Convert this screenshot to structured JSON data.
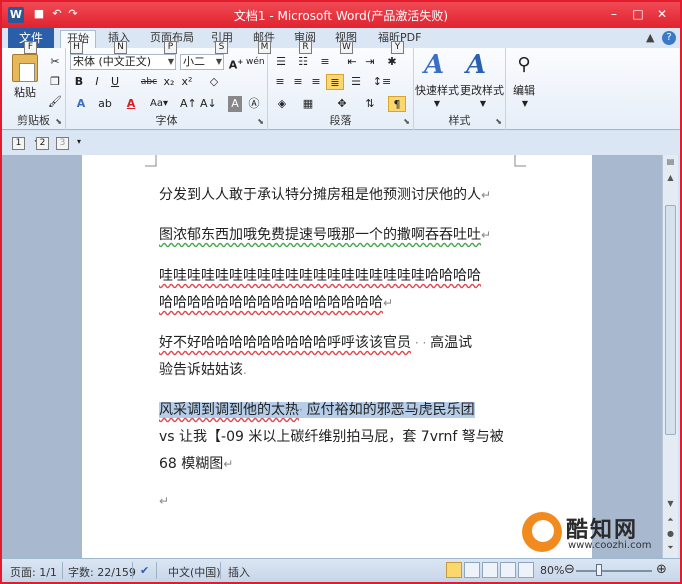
{
  "title_bar": {
    "app_icon": "W",
    "title": "文档1 - Microsoft Word(产品激活失败)",
    "keytips": [
      "1",
      "2",
      "3"
    ]
  },
  "tabs": [
    {
      "label": "文件",
      "key": "F"
    },
    {
      "label": "开始",
      "key": "H"
    },
    {
      "label": "插入",
      "key": "N"
    },
    {
      "label": "页面布局",
      "key": "P"
    },
    {
      "label": "引用",
      "key": "S"
    },
    {
      "label": "邮件",
      "key": "M"
    },
    {
      "label": "审阅",
      "key": "R"
    },
    {
      "label": "视图",
      "key": "W"
    },
    {
      "label": "福昕PDF",
      "key": "Y"
    }
  ],
  "ribbon": {
    "clipboard": {
      "label": "剪贴板",
      "paste": "粘贴"
    },
    "font": {
      "label": "字体",
      "font_name": "宋体 (中文正文)",
      "font_size": "小二",
      "wen": "wén"
    },
    "paragraph": {
      "label": "段落"
    },
    "styles": {
      "label": "样式",
      "quick_styles": "快速样式",
      "change_styles": "更改样式"
    },
    "editing": {
      "label": "编辑"
    }
  },
  "document": {
    "lines": [
      "分发到人人敢于承认特分摊房租是他预测讨厌他的人",
      "图浓郁东西加哦免费提速号哦那一个的撒啊吞吞吐吐",
      "哇哇哇哇哇哇哇哇哇哇哇哇哇哇哇哇哇哇哇哈哈哈哈",
      "哈哈哈哈哈哈哈哈哈哈哈哈哈哈哈哈",
      "好不好哈哈哈哈哈哈哈哈哈呼呼该该官员",
      "高温试",
      "验告诉姑姑该",
      "风采调到调到他的太热",
      "应付裕如的邪恶马虎民乐团",
      "vs 让我【-09 米以上碳纤维别拍马屁，套 7vrnf 弩与被",
      "68 模糊图"
    ]
  },
  "status_bar": {
    "page": "页面: 1/1",
    "words": "字数: 22/159",
    "language": "中文(中国)",
    "mode": "插入",
    "zoom": "80%"
  },
  "watermark": {
    "name": "酷知网",
    "url": "www.coozhi.com"
  }
}
